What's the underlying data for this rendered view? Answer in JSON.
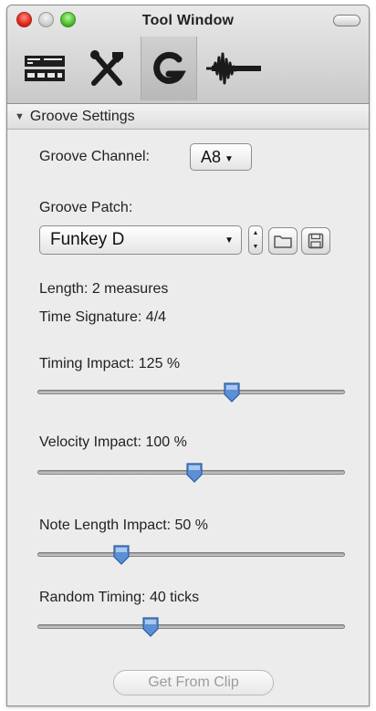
{
  "window": {
    "title": "Tool Window"
  },
  "toolbar": {
    "tools": [
      {
        "icon": "transport-icon",
        "selected": false
      },
      {
        "icon": "tools-icon",
        "selected": false
      },
      {
        "icon": "groove-icon",
        "selected": true
      },
      {
        "icon": "waveform-icon",
        "selected": false
      }
    ]
  },
  "section": {
    "title": "Groove Settings",
    "expanded": true
  },
  "groove_channel": {
    "label": "Groove Channel:",
    "value": "A8"
  },
  "groove_patch": {
    "label": "Groove Patch:",
    "value": "Funkey D"
  },
  "info": {
    "length": "Length: 2 measures",
    "time_signature": "Time Signature: 4/4"
  },
  "sliders": [
    {
      "label": "Timing Impact: 125 %",
      "fraction": 0.64
    },
    {
      "label": "Velocity Impact: 100 %",
      "fraction": 0.51
    },
    {
      "label": "Note Length Impact: 50 %",
      "fraction": 0.26
    },
    {
      "label": "Random Timing: 40 ticks",
      "fraction": 0.36
    }
  ],
  "get_from_clip": {
    "label": "Get From Clip",
    "enabled": false
  },
  "colors": {
    "slider_thumb": "#5b8fd6",
    "close": "#e0251b",
    "zoom": "#4cbf2a"
  }
}
